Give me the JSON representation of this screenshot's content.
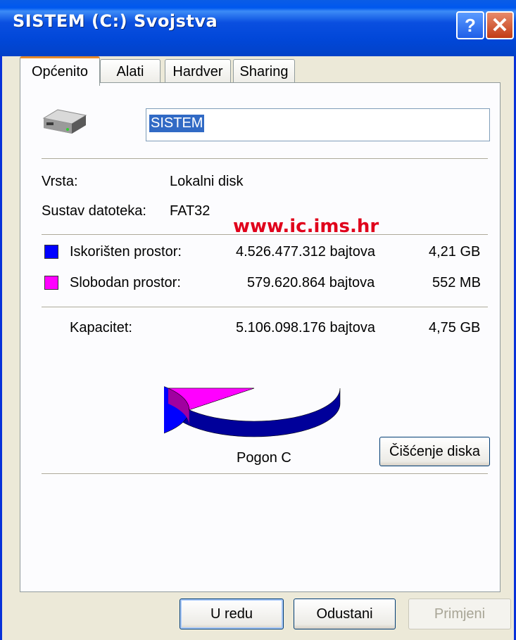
{
  "window": {
    "title": "SISTEM (C:) Svojstva",
    "help_label": "?",
    "close_label": "✕"
  },
  "tabs": [
    {
      "label": "Općenito",
      "active": true
    },
    {
      "label": "Alati",
      "active": false
    },
    {
      "label": "Hardver",
      "active": false
    },
    {
      "label": "Sharing",
      "active": false
    }
  ],
  "general": {
    "drive_icon": "hard-drive-icon",
    "name_value": "SISTEM",
    "type_label": "Vrsta:",
    "type_value": "Lokalni disk",
    "fs_label": "Sustav datoteka:",
    "fs_value": "FAT32",
    "watermark": "www.ic.ims.hr",
    "used": {
      "label": "Iskorišten prostor:",
      "bytes": "4.526.477.312 bajtova",
      "size": "4,21 GB",
      "color": "#0000ff"
    },
    "free": {
      "label": "Slobodan prostor:",
      "bytes": "579.620.864 bajtova",
      "size": "552 MB",
      "color": "#ff00ff"
    },
    "capacity": {
      "label": "Kapacitet:",
      "bytes": "5.106.098.176 bajtova",
      "size": "4,75 GB"
    },
    "drive_label": "Pogon C",
    "cleanup_button": "Čišćenje diska"
  },
  "chart_data": {
    "type": "pie",
    "slices": [
      {
        "name": "Iskorišten prostor",
        "value": 4526477312,
        "color": "#0000ff"
      },
      {
        "name": "Slobodan prostor",
        "value": 579620864,
        "color": "#ff00ff"
      }
    ]
  },
  "footer": {
    "ok": "U redu",
    "cancel": "Odustani",
    "apply": "Primjeni"
  }
}
